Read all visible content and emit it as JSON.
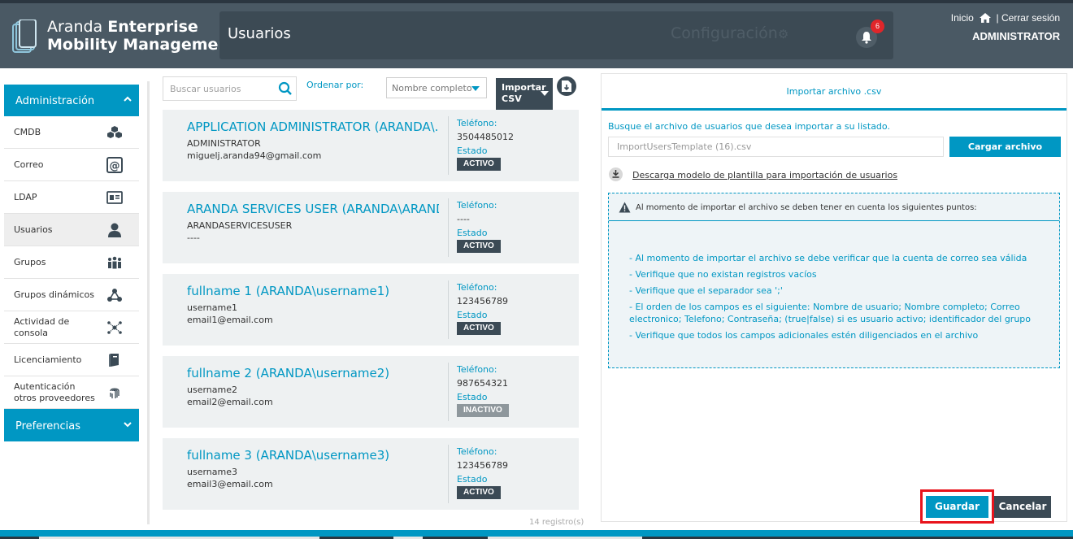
{
  "header": {
    "brand_line1_light": "Aranda",
    "brand_line1_bold": "Enterprise",
    "brand_line2": "Mobility Management",
    "page_title": "Usuarios",
    "config_label": "Configuración",
    "notification_count": "6",
    "home_link": "Inicio",
    "separator": "|",
    "logout_link": "Cerrar sesión",
    "user": "ADMINISTRATOR"
  },
  "sidebar": {
    "admin_header": "Administración",
    "items": [
      {
        "label": "CMDB",
        "icon": "cubes-icon"
      },
      {
        "label": "Correo",
        "icon": "at-icon"
      },
      {
        "label": "LDAP",
        "icon": "id-card-icon"
      },
      {
        "label": "Usuarios",
        "icon": "user-icon"
      },
      {
        "label": "Grupos",
        "icon": "group-icon"
      },
      {
        "label": "Grupos dinámicos",
        "icon": "share-icon"
      },
      {
        "label": "Actividad de consola",
        "icon": "network-icon"
      },
      {
        "label": "Licenciamiento",
        "icon": "book-icon"
      },
      {
        "label": "Autenticación otros proveedores",
        "icon": "fingerprint-icon"
      }
    ],
    "pref_header": "Preferencias"
  },
  "toolbar": {
    "search_placeholder": "Buscar usuarios",
    "order_label": "Ordenar por:",
    "order_value": "Nombre completo",
    "import_label_1": "Importar",
    "import_label_2": "CSV"
  },
  "users": [
    {
      "name": "APPLICATION ADMINISTRATOR (ARANDA\\...",
      "username": "ADMINISTRATOR",
      "email": "miguelj.aranda94@gmail.com",
      "phone_label": "Teléfono:",
      "phone": "3504485012",
      "status_label": "Estado",
      "status": "ACTIVO"
    },
    {
      "name": "ARANDA SERVICES USER (ARANDA\\ARAND...",
      "username": "ARANDASERVICESUSER",
      "email": "----",
      "phone_label": "Teléfono:",
      "phone": "----",
      "status_label": "Estado",
      "status": "ACTIVO"
    },
    {
      "name": "fullname 1 (ARANDA\\username1)",
      "username": "username1",
      "email": "email1@email.com",
      "phone_label": "Teléfono:",
      "phone": "123456789",
      "status_label": "Estado",
      "status": "ACTIVO"
    },
    {
      "name": "fullname 2 (ARANDA\\username2)",
      "username": "username2",
      "email": "email2@email.com",
      "phone_label": "Teléfono:",
      "phone": "987654321",
      "status_label": "Estado",
      "status": "INACTIVO"
    },
    {
      "name": "fullname 3 (ARANDA\\username3)",
      "username": "username3",
      "email": "email3@email.com",
      "phone_label": "Teléfono:",
      "phone": "123456789",
      "status_label": "Estado",
      "status": "ACTIVO"
    }
  ],
  "record_count": "14 registro(s)",
  "import_panel": {
    "title": "Importar archivo .csv",
    "hint": "Busque el archivo de usuarios que desea importar a su listado.",
    "file_value": "ImportUsersTemplate (16).csv",
    "load_button": "Cargar archivo",
    "download_link": "Descarga modelo de plantilla para importación de usuarios",
    "notice_title": "Al momento de importar el archivo se deben tener en cuenta los siguientes puntos:",
    "notice_points": [
      "- Al momento de importar el archivo se debe verificar que la cuenta de correo sea válida",
      "- Verifique que no existan registros vacíos",
      "- Verifique que el separador sea ';'",
      "- El orden de los campos es el siguiente: Nombre de usuario; Nombre completo; Correo electronico; Telefono; Contraseña; (true|false) si es usuario activo; identificador del grupo",
      "- Verifique que todos los campos adicionales estén diligenciados en el archivo"
    ],
    "save_button": "Guardar",
    "cancel_button": "Cancelar"
  },
  "colors": {
    "accent": "#0097c3",
    "header_bg": "#4a5964",
    "dark_button": "#3b4a55",
    "inactive_badge": "#8e979c",
    "highlight": "#e8141c"
  }
}
